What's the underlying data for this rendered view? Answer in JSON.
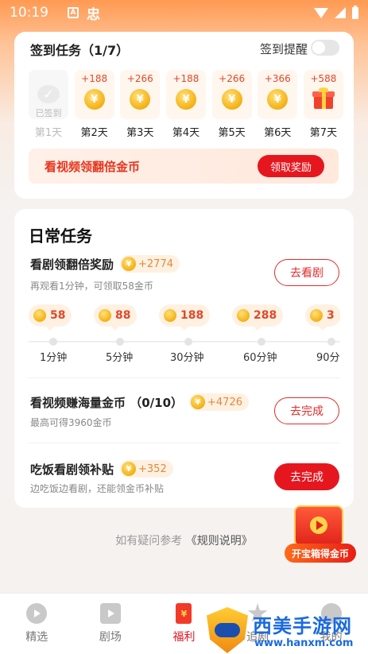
{
  "status_bar": {
    "time": "10:19",
    "notif_a": "A",
    "notif_icon": "忠"
  },
  "signin": {
    "title": "签到任务（1/7）",
    "remind_label": "签到提醒",
    "remind_on": false,
    "days": [
      {
        "amount": "",
        "label": "第1天",
        "done": true,
        "done_text": "已签到",
        "icon": "check-icon"
      },
      {
        "amount": "+188",
        "label": "第2天",
        "done": false,
        "icon": "coin-icon"
      },
      {
        "amount": "+266",
        "label": "第3天",
        "done": false,
        "icon": "coin-icon"
      },
      {
        "amount": "+188",
        "label": "第4天",
        "done": false,
        "icon": "coin-icon"
      },
      {
        "amount": "+266",
        "label": "第5天",
        "done": false,
        "icon": "coin-icon"
      },
      {
        "amount": "+366",
        "label": "第6天",
        "done": false,
        "icon": "coin-icon"
      },
      {
        "amount": "+588",
        "label": "第7天",
        "done": false,
        "icon": "gift-icon"
      }
    ],
    "coin_symbol": "¥",
    "video_text": "看视频领翻倍金币",
    "claim_button": "领取奖励"
  },
  "daily": {
    "title": "日常任务",
    "tasks": [
      {
        "title": "看剧领翻倍奖励",
        "reward": "+2774",
        "subtitle": "再观看1分钟，可领取58金币",
        "button": "去看剧",
        "button_style": "outline"
      },
      {
        "title": "看视频赚海量金币 （0/10）",
        "reward": "+4726",
        "subtitle": "最高可得3960金币",
        "button": "去完成",
        "button_style": "outline"
      },
      {
        "title": "吃饭看剧领补贴",
        "reward": "+352",
        "subtitle": "边吃饭边看剧，还能领金币补贴",
        "button": "去完成",
        "button_style": "filled"
      }
    ],
    "milestones": [
      {
        "coins": "58",
        "time": "1分钟"
      },
      {
        "coins": "88",
        "time": "5分钟"
      },
      {
        "coins": "188",
        "time": "30分钟"
      },
      {
        "coins": "288",
        "time": "60分钟"
      },
      {
        "coins": "3",
        "time": "90分"
      }
    ]
  },
  "rules": {
    "prefix": "如有疑问参考",
    "link": "《规则说明》"
  },
  "chest": {
    "label": "开宝箱得金币"
  },
  "tabbar": {
    "tabs": [
      {
        "label": "精选",
        "icon": "play-circle-icon",
        "active": false
      },
      {
        "label": "剧场",
        "icon": "tv-icon",
        "active": false
      },
      {
        "label": "福利",
        "icon": "red-envelope-icon",
        "active": true
      },
      {
        "label": "追剧",
        "icon": "star-icon",
        "active": false
      },
      {
        "label": "我的",
        "icon": "face-icon",
        "active": false
      }
    ],
    "welfare_glyph": "¥"
  },
  "watermark": {
    "text": "西美手游网",
    "url": "www.hanxm.com"
  },
  "colors": {
    "accent_red": "#e6161f",
    "coin_gold": "#f5b419",
    "header_orange": "#ff9a52"
  }
}
